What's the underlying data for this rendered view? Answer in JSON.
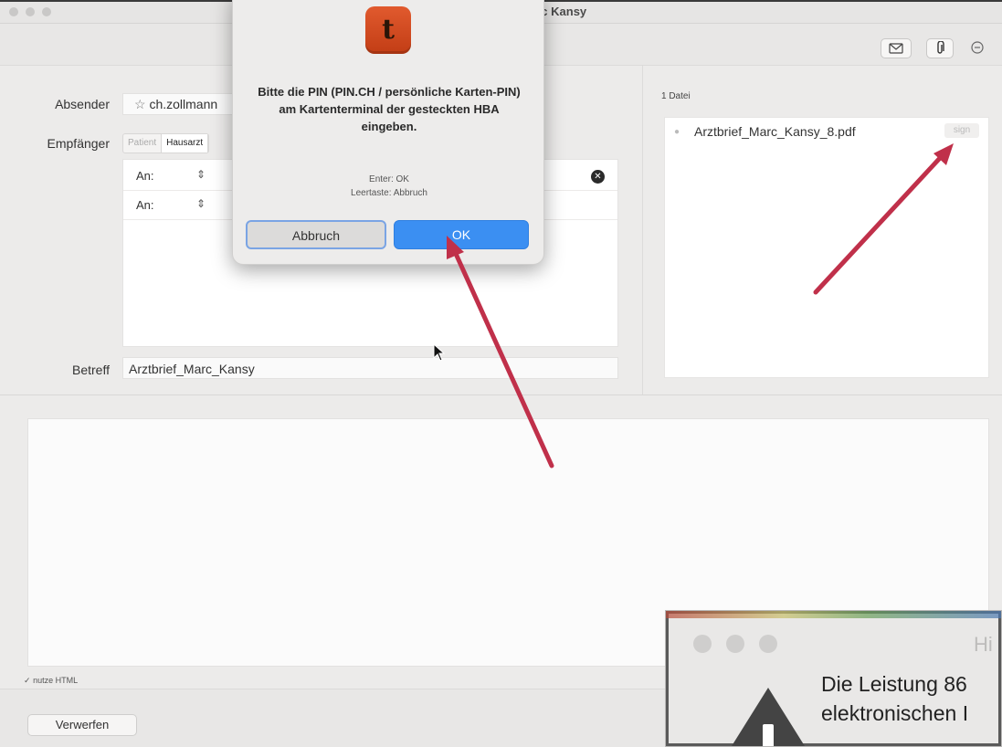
{
  "window": {
    "title": "arc Kansy"
  },
  "toolbar": {
    "icons": [
      "envelope-icon",
      "paperclip-icon",
      "minus-circle-icon"
    ]
  },
  "form": {
    "sender_label": "Absender",
    "sender_value": "ch.zollmann",
    "recipient_label": "Empfänger",
    "recipient_tabs": [
      {
        "label": "Patient",
        "active": false
      },
      {
        "label": "Hausarzt",
        "active": true
      }
    ],
    "recipient_rows": [
      {
        "type": "An:",
        "value": ""
      },
      {
        "type": "An:",
        "value": ""
      }
    ],
    "subject_label": "Betreff",
    "subject_value": "Arztbrief_Marc_Kansy"
  },
  "attachments": {
    "count_label": "1 Datei",
    "files": [
      {
        "name": "Arztbrief_Marc_Kansy_8.pdf",
        "action": "sign"
      }
    ]
  },
  "footer": {
    "html_checkbox_label": "nutze HTML",
    "html_checkbox_checked": true,
    "discard_label": "Verwerfen"
  },
  "dialog": {
    "icon_letter": "t",
    "message": "Bitte die PIN (PIN.CH / persönliche Karten-PIN) am Kartenterminal der gesteckten HBA eingeben.",
    "hint_enter": "Enter: OK",
    "hint_space": "Leertaste: Abbruch",
    "cancel_label": "Abbruch",
    "ok_label": "OK",
    "ok_color": "#3b8ff2"
  },
  "alert2": {
    "title_partial": "Hi",
    "text_line1": "Die Leistung 86",
    "text_line2": "elektronischen I"
  },
  "annotation": {
    "arrow_color": "#c0304a"
  }
}
